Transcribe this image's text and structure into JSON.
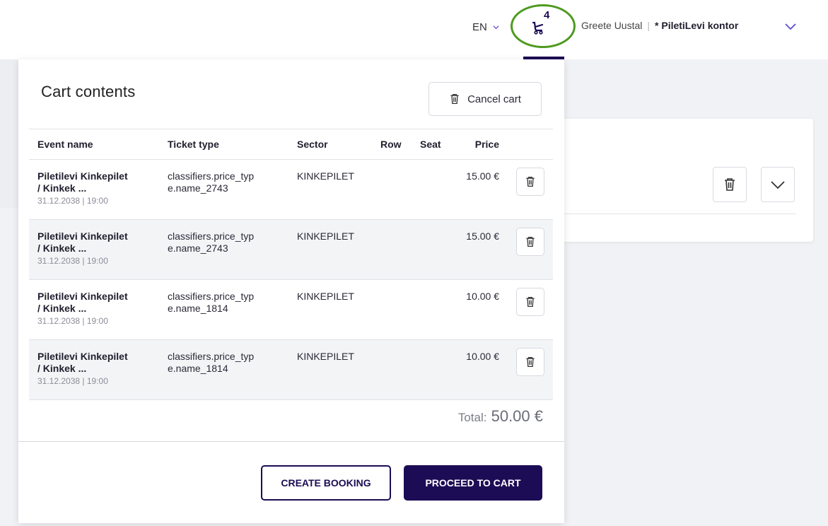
{
  "header": {
    "language": "EN",
    "cart_count": "4",
    "user_name": "Greete Uustal",
    "separator": "|",
    "organization": "* PiletiLevi kontor"
  },
  "cart": {
    "title": "Cart contents",
    "cancel_label": "Cancel cart",
    "columns": [
      "Event name",
      "Ticket type",
      "Sector",
      "Row",
      "Seat",
      "Price"
    ],
    "items": [
      {
        "event_line1": "Piletilevi Kinkepilet",
        "event_line2": "/ Kinkek ...",
        "date": "31.12.2038 | 19:00",
        "ticket_line1": "classifiers.price_typ",
        "ticket_line2": "e.name_2743",
        "sector": "KINKEPILET",
        "row": "",
        "seat": "",
        "price": "15.00 €"
      },
      {
        "event_line1": "Piletilevi Kinkepilet",
        "event_line2": "/ Kinkek ...",
        "date": "31.12.2038 | 19:00",
        "ticket_line1": "classifiers.price_typ",
        "ticket_line2": "e.name_2743",
        "sector": "KINKEPILET",
        "row": "",
        "seat": "",
        "price": "15.00 €"
      },
      {
        "event_line1": "Piletilevi Kinkepilet",
        "event_line2": "/ Kinkek ...",
        "date": "31.12.2038 | 19:00",
        "ticket_line1": "classifiers.price_typ",
        "ticket_line2": "e.name_1814",
        "sector": "KINKEPILET",
        "row": "",
        "seat": "",
        "price": "10.00 €"
      },
      {
        "event_line1": "Piletilevi Kinkepilet",
        "event_line2": "/ Kinkek ...",
        "date": "31.12.2038 | 19:00",
        "ticket_line1": "classifiers.price_typ",
        "ticket_line2": "e.name_1814",
        "sector": "KINKEPILET",
        "row": "",
        "seat": "",
        "price": "10.00 €"
      }
    ],
    "total_label": "Total:",
    "total_value": "50.00 €",
    "create_booking_label": "CREATE BOOKING",
    "proceed_label": "PROCEED TO CART"
  },
  "colors": {
    "brand": "#1c0c55",
    "highlight_ring": "#4e9a1e",
    "page_bg": "#f1f2f6"
  },
  "icons": {
    "cart": "cart-icon",
    "trash": "trash-icon",
    "chevron": "chevron-down-icon"
  }
}
